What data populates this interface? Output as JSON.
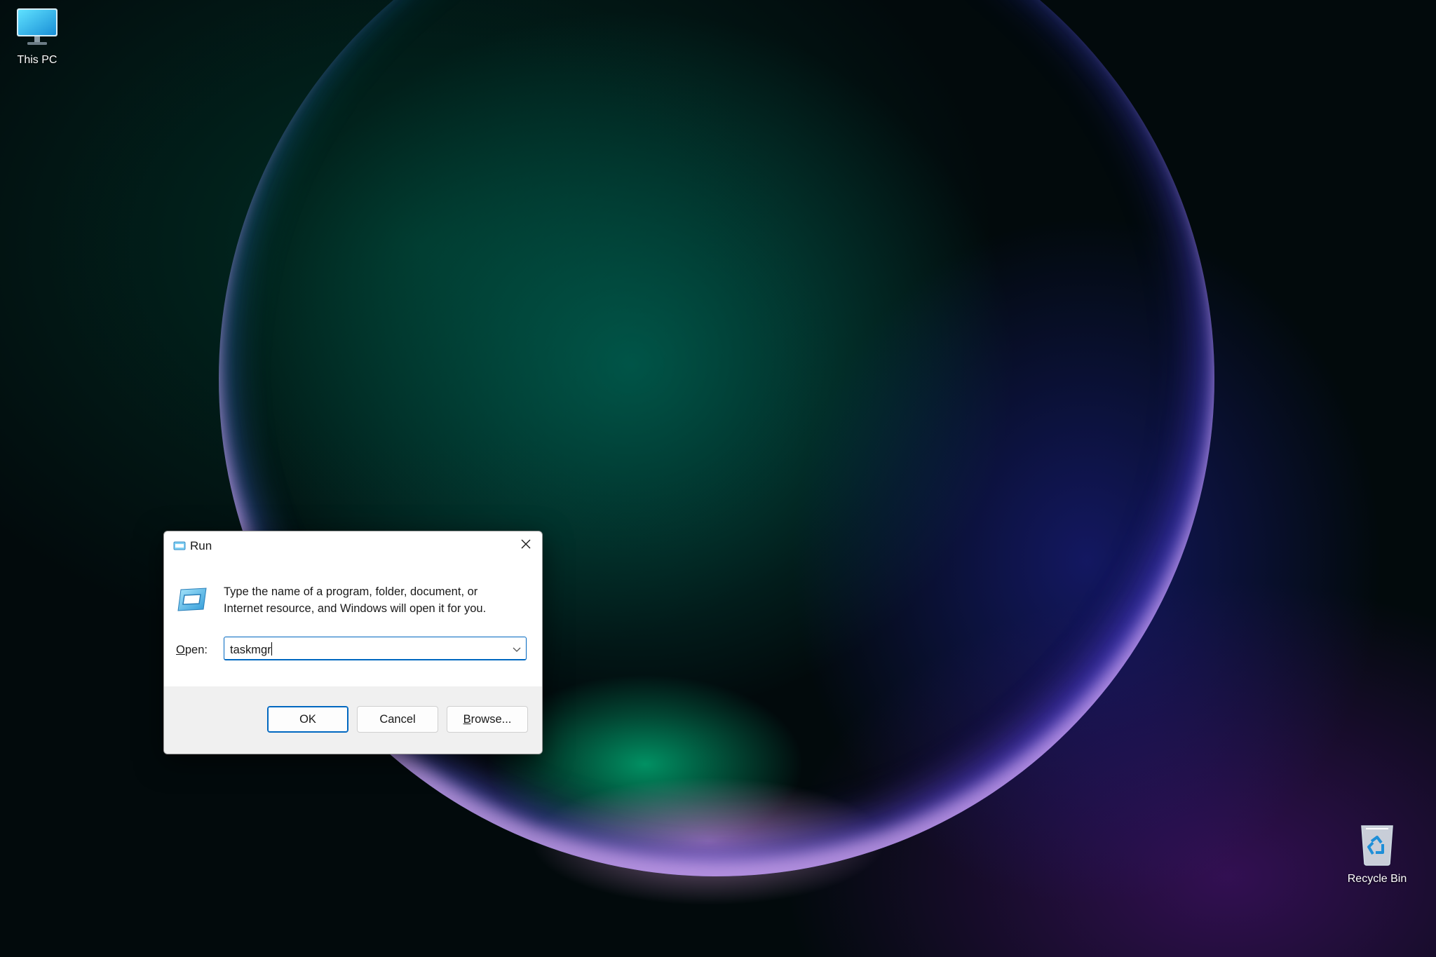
{
  "desktop": {
    "icons": [
      {
        "label": "This PC",
        "icon": "monitor-icon"
      },
      {
        "label": "Recycle Bin",
        "icon": "recycle-bin-icon"
      }
    ]
  },
  "run_dialog": {
    "title": "Run",
    "title_icon": "run-icon",
    "description": "Type the name of a program, folder, document, or Internet resource, and Windows will open it for you.",
    "open_label_accel": "O",
    "open_label_rest": "pen:",
    "open_value": "taskmgr",
    "buttons": {
      "ok": "OK",
      "cancel": "Cancel",
      "browse_accel": "B",
      "browse_rest": "rowse..."
    }
  },
  "colors": {
    "accent": "#0067c0",
    "dialog_footer": "#f0f0f0"
  }
}
